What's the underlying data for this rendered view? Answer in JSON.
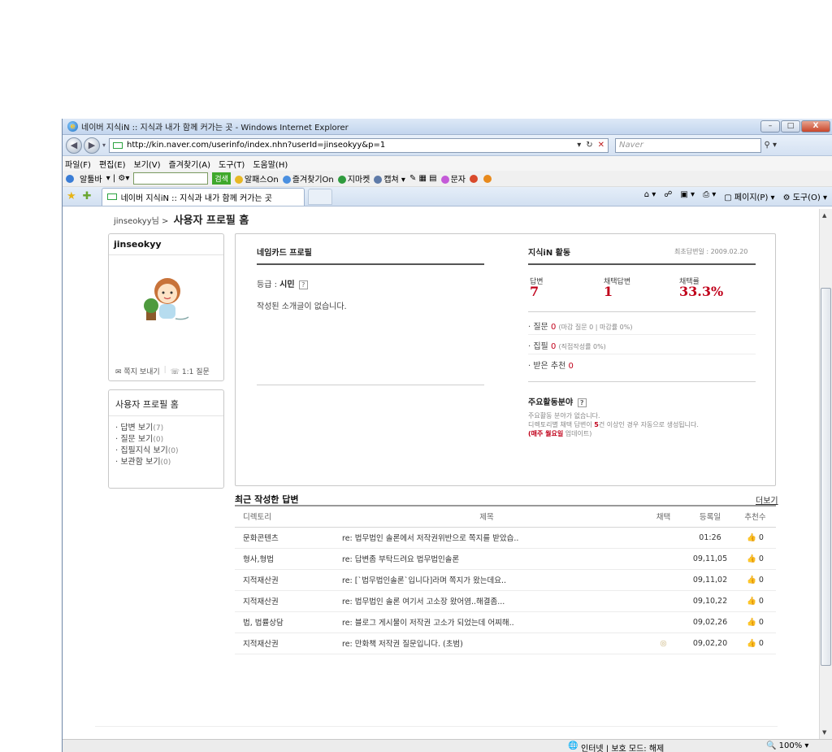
{
  "browser": {
    "window_title": "네이버 지식iN :: 지식과 내가 함께 커가는 곳 - Windows Internet Explorer",
    "url": "http://kin.naver.com/userinfo/index.nhn?userId=jinseokyy&p=1",
    "search_placeholder": "Naver",
    "menu": [
      "파일(F)",
      "편집(E)",
      "보기(V)",
      "즐겨찾기(A)",
      "도구(T)",
      "도움말(H)"
    ],
    "toolbar": {
      "alttoolbar": "알툴바",
      "search_button": "검색",
      "items": [
        "알패스On",
        "즐겨찾기On",
        "지마켓",
        "캡쳐",
        "문자"
      ]
    },
    "tab_title": "네이버 지식iN :: 지식과 내가 함께 커가는 곳",
    "commands": [
      "페이지(P)",
      "도구(O)"
    ],
    "status": {
      "zone": "인터넷 | 보호 모드: 해제",
      "zoom": "100%"
    }
  },
  "page": {
    "breadcrumb_user": "jinseokyy님 >",
    "breadcrumb_title": "사용자 프로필 홈",
    "profile": {
      "username": "jinseokyy",
      "send_note": "쪽지 보내기",
      "one_to_one": "1:1 질문"
    },
    "side_menu": {
      "title": "사용자 프로필 홈",
      "items": [
        {
          "label": "· 답변 보기",
          "count": "(7)"
        },
        {
          "label": "· 질문 보기",
          "count": "(0)"
        },
        {
          "label": "· 집필지식 보기",
          "count": "(0)"
        },
        {
          "label": "· 보관함 보기",
          "count": "(0)"
        }
      ]
    },
    "namecard": {
      "title": "네임카드 프로필",
      "grade_label": "등급 :",
      "grade_value": "시민",
      "intro": "작성된 소개글이 없습니다."
    },
    "activity": {
      "title": "지식iN 활동",
      "first_answer": "최초답변일 : 2009.02.20",
      "answers_label": "답변",
      "answers_value": "7",
      "selected_label": "채택답변",
      "selected_value": "1",
      "rate_label": "채택률",
      "rate_value": "33.3%",
      "questions_label": "· 질문",
      "questions_value": "0",
      "questions_note": "(마감 질문 0 | 마감률 0%)",
      "writing_label": "· 집필",
      "writing_value": "0",
      "writing_note": "(직접작성률 0%)",
      "recommend_label": "· 받은 추천",
      "recommend_value": "0"
    },
    "field": {
      "title": "주요활동분야",
      "line1": "주요활동 분야가 없습니다.",
      "line2_pre": "디렉토리별 채택 답변이",
      "line2_num": "5",
      "line2_post": "건 이상인 경우 자동으로 생성됩니다.",
      "line3_em": "(매주 월요일",
      "line3_post": "업데이트)"
    },
    "recent": {
      "title": "최근 작성한 답변",
      "more": "더보기",
      "columns": [
        "디렉토리",
        "제목",
        "채택",
        "등록일",
        "추천수"
      ],
      "rows": [
        {
          "category": "문화콘텐츠",
          "subject": "re: 법무법인 솔론에서 저작권위반으로 쪽지를 받았습..",
          "selected": "",
          "date": "01:26",
          "recommend": "0"
        },
        {
          "category": "형사,형법",
          "subject": "re: 답변좀 부탁드려요 법무법인솔론",
          "selected": "",
          "date": "09,11,05",
          "recommend": "0"
        },
        {
          "category": "지적재산권",
          "subject": "re: [`법무법인솔론`입니다]라며 쪽지가 왔는데요..",
          "selected": "",
          "date": "09,11,02",
          "recommend": "0"
        },
        {
          "category": "지적재산권",
          "subject": "re: 법무법인 솔론 여기서 고소장 왔어염..해결좀...",
          "selected": "",
          "date": "09,10,22",
          "recommend": "0"
        },
        {
          "category": "법, 법률상담",
          "subject": "re: 블로그 게시물이 저작권 고소가 되었는데 어찌해..",
          "selected": "",
          "date": "09,02,26",
          "recommend": "0"
        },
        {
          "category": "지적재산권",
          "subject": "re: 만화책 저작권 질문입니다. (초범)",
          "selected": "medal",
          "date": "09,02,20",
          "recommend": "0"
        }
      ]
    }
  }
}
